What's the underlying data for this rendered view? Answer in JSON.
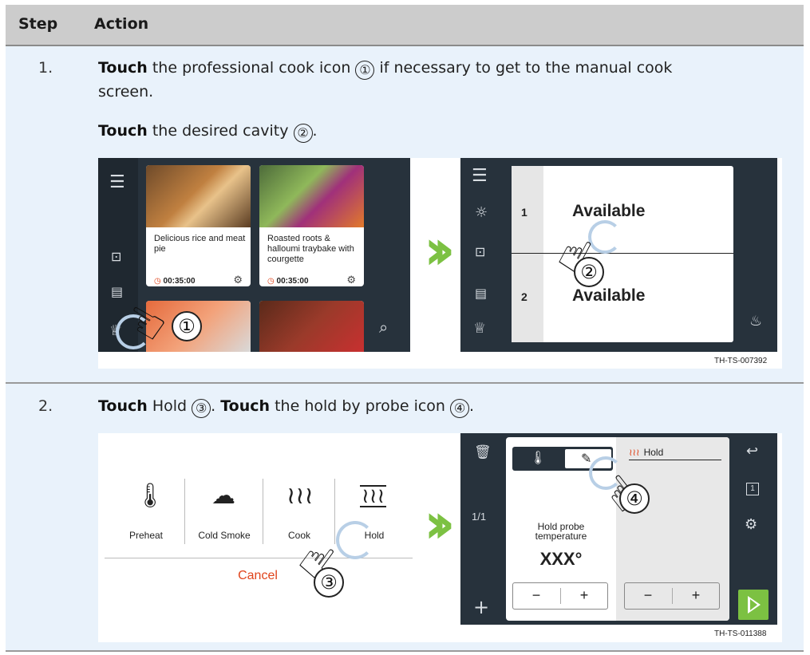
{
  "table": {
    "headers": [
      "Step",
      "Action"
    ],
    "steps": [
      {
        "number": "1.",
        "line1_bold": "Touch",
        "line1_text": " the professional cook icon ",
        "line1_marker": "①",
        "line1_tail": " if necessary to get to the manual cook",
        "line2_text": "screen.",
        "line3_bold": "Touch",
        "line3_text": " the desired cavity ",
        "line3_marker": "②",
        "line3_tail": "."
      },
      {
        "number": "2.",
        "line1_bold1": "Touch",
        "line1_text1": " Hold ",
        "line1_marker1": "③",
        "line1_text2": ". ",
        "line1_bold2": "Touch",
        "line1_text3": " the hold by probe icon ",
        "line1_marker2": "④",
        "line1_tail": "."
      }
    ]
  },
  "figure1": {
    "recipes": [
      {
        "title": "Delicious rice and meat pie",
        "time": "00:35:00"
      },
      {
        "title": "Roasted roots & halloumi traybake with courgette",
        "time": "00:35:00"
      }
    ],
    "cavities": [
      {
        "number": "1",
        "status": "Available"
      },
      {
        "number": "2",
        "status": "Available"
      }
    ],
    "callouts": [
      "①",
      "②"
    ],
    "ref_code": "TH-TS-007392"
  },
  "figure2": {
    "modes": [
      "Preheat",
      "Cold Smoke",
      "Cook",
      "Hold"
    ],
    "cancel_label": "Cancel",
    "page_indicator": "1/1",
    "hold_tab_label": "Hold",
    "probe_label": "Hold probe temperature",
    "probe_value": "XXX°",
    "minus": "−",
    "plus": "+",
    "slot_label": "1",
    "callouts": [
      "③",
      "④"
    ],
    "ref_code": "TH-TS-011388"
  },
  "colors": {
    "header_bg": "#cccccc",
    "row_bg": "#e9f2fb",
    "dark_ui": "#27323c",
    "accent_green": "#7cc142",
    "accent_red": "#e0441b"
  }
}
